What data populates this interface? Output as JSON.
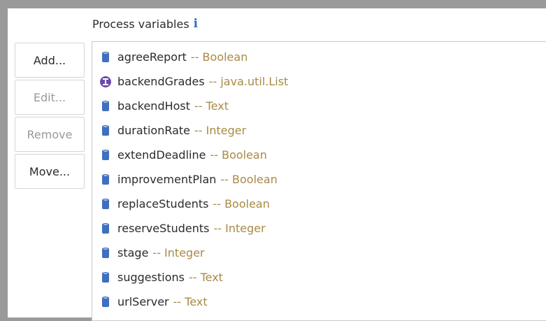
{
  "header": {
    "title": "Process variables",
    "info_icon": "info-icon"
  },
  "buttons": {
    "add": "Add...",
    "edit": "Edit...",
    "remove": "Remove",
    "move": "Move..."
  },
  "colors": {
    "type_text": "#a88a45",
    "icon_blue": "#3f6fbf",
    "icon_purple": "#6b4bab"
  },
  "variables": [
    {
      "name": "agreeReport",
      "type": "-- Boolean",
      "icon": "cylinder-icon"
    },
    {
      "name": "backendGrades",
      "type": "-- java.util.List",
      "icon": "java-object-icon"
    },
    {
      "name": "backendHost",
      "type": "-- Text",
      "icon": "cylinder-icon"
    },
    {
      "name": "durationRate",
      "type": "-- Integer",
      "icon": "cylinder-icon"
    },
    {
      "name": "extendDeadline",
      "type": "-- Boolean",
      "icon": "cylinder-icon"
    },
    {
      "name": "improvementPlan",
      "type": "-- Boolean",
      "icon": "cylinder-icon"
    },
    {
      "name": "replaceStudents",
      "type": "-- Boolean",
      "icon": "cylinder-icon"
    },
    {
      "name": "reserveStudents",
      "type": "-- Integer",
      "icon": "cylinder-icon"
    },
    {
      "name": "stage",
      "type": "-- Integer",
      "icon": "cylinder-icon"
    },
    {
      "name": "suggestions",
      "type": "-- Text",
      "icon": "cylinder-icon"
    },
    {
      "name": "urlServer",
      "type": "-- Text",
      "icon": "cylinder-icon"
    }
  ]
}
